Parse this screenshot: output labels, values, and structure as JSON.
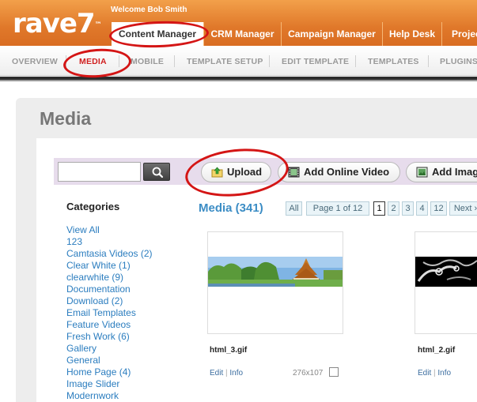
{
  "header": {
    "logo": "rave7",
    "logo_mark": "™",
    "welcome": "Welcome Bob Smith",
    "tabs": [
      {
        "label": "Content Manager"
      },
      {
        "label": "CRM Manager"
      },
      {
        "label": "Campaign Manager"
      },
      {
        "label": "Help Desk"
      },
      {
        "label": "Projects"
      }
    ],
    "colors": {
      "brand": "#e0782a",
      "active_tab": "#ffffff"
    }
  },
  "subnav": {
    "items": [
      {
        "label": "OVERVIEW"
      },
      {
        "label": "MEDIA"
      },
      {
        "label": "MOBILE"
      },
      {
        "label": "TEMPLATE SETUP"
      },
      {
        "label": "EDIT TEMPLATE"
      },
      {
        "label": "TEMPLATES"
      },
      {
        "label": "PLUGINS"
      }
    ],
    "active": "MEDIA"
  },
  "page": {
    "title": "Media"
  },
  "toolbar": {
    "search": {
      "value": "",
      "placeholder": ""
    },
    "search_icon": "magnifier-icon",
    "upload_label": "Upload",
    "add_video_label": "Add Online Video",
    "add_image_label": "Add Image"
  },
  "categories": {
    "title": "Categories",
    "items": [
      "View All",
      "123",
      "Camtasia Videos (2)",
      "Clear White (1)",
      "clearwhite (9)",
      "Documentation",
      "Download (2)",
      "Email Templates",
      "Feature Videos",
      "Fresh Work (6)",
      "Gallery",
      "General",
      "Home Page (4)",
      "Image Slider",
      "Modernwork"
    ]
  },
  "media": {
    "count_label": "Media (341)",
    "pager": {
      "all": "All",
      "page_info": "Page 1 of 12",
      "pages": [
        "1",
        "2",
        "3",
        "4",
        "12"
      ],
      "current": "1",
      "next": "Next ›"
    },
    "items": [
      {
        "filename": "html_3.gif",
        "edit": "Edit",
        "sep": "|",
        "info": "Info",
        "dims": "276x107"
      },
      {
        "filename": "html_2.gif",
        "edit": "Edit",
        "sep": "|",
        "info": "Info",
        "dims": ""
      }
    ]
  },
  "annotations": {
    "ring_color": "#d41515"
  }
}
